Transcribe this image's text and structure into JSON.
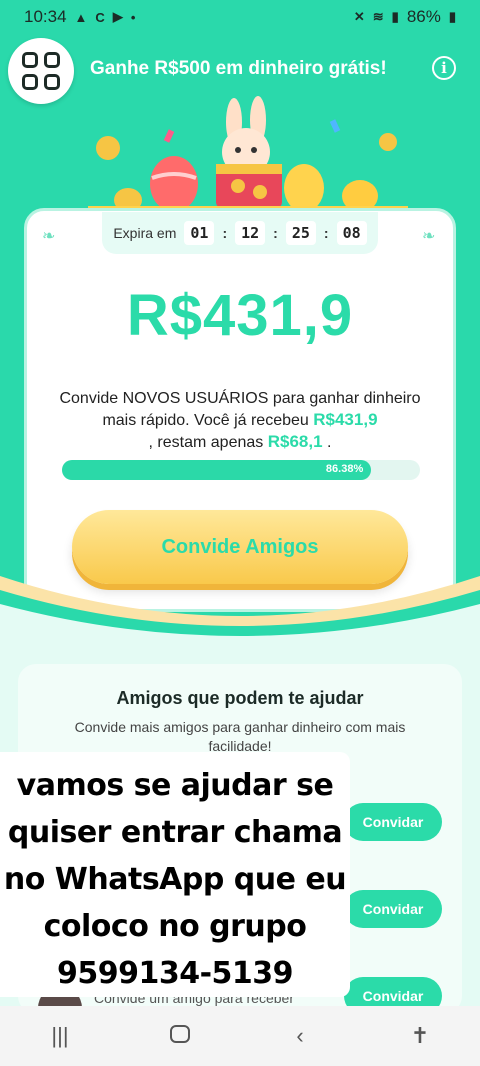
{
  "status": {
    "time": "10:34",
    "left_icons": [
      "warning-icon",
      "sync-icon",
      "youtube-icon",
      "dot-icon"
    ],
    "battery": "86%",
    "right_icons": [
      "mute-icon",
      "wifi-icon",
      "signal-icon",
      "battery-icon"
    ]
  },
  "header": {
    "title": "Ganhe R$500 em dinheiro grátis!"
  },
  "timer": {
    "label": "Expira em",
    "days": "01",
    "hours": "12",
    "minutes": "25",
    "seconds": "08"
  },
  "reward": {
    "amount": "R$431,9",
    "desc_part1": "Convide NOVOS USUÁRIOS para ganhar dinheiro mais rápido. Você já recebeu",
    "received": "R$431,9",
    "desc_part2": ", restam apenas",
    "remaining": "R$68,1",
    "desc_part3": ".",
    "progress_label": "86.38%",
    "progress_value": 0.8638
  },
  "invite_button": "Convide Amigos",
  "friends": {
    "title": "Amigos que podem te ajudar",
    "subtitle": "Convide mais amigos para ganhar dinheiro com mais facilidade!",
    "button_label": "Convidar",
    "partial_text": "Convide um amigo para receber"
  },
  "overlay": {
    "line1": "vamos se ajudar se",
    "line2": "quiser entrar chama",
    "line3": "no WhatsApp que eu",
    "line4": "coloco no grupo",
    "line5": "9599134-5139"
  },
  "colors": {
    "brand": "#2ad9ab",
    "accent_gold": "#f9c94b"
  }
}
